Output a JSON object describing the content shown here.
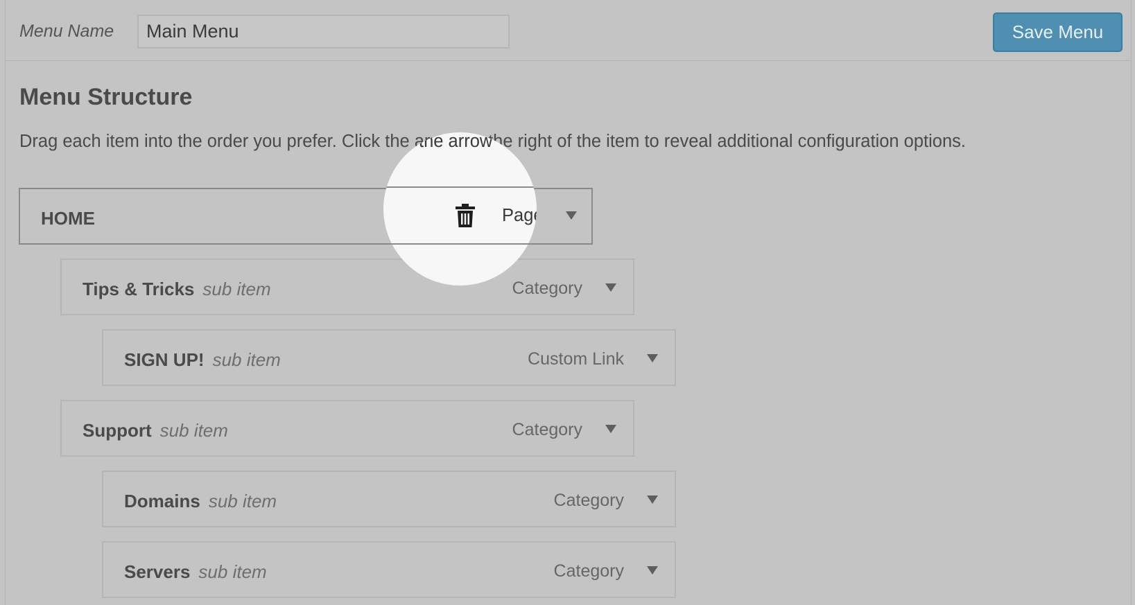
{
  "header": {
    "menu_name_label": "Menu Name",
    "menu_name_value": "Main Menu",
    "save_label": "Save Menu"
  },
  "structure": {
    "title": "Menu Structure",
    "instructions": "Drag each item into the order you prefer. Click the arrow on the right of the item to reveal additional configuration options."
  },
  "items": [
    {
      "title": "HOME",
      "sub": "",
      "type": "Page"
    },
    {
      "title": "Tips & Tricks",
      "sub": "sub item",
      "type": "Category"
    },
    {
      "title": "SIGN UP!",
      "sub": "sub item",
      "type": "Custom Link"
    },
    {
      "title": "Support",
      "sub": "sub item",
      "type": "Category"
    },
    {
      "title": "Domains",
      "sub": "sub item",
      "type": "Category"
    },
    {
      "title": "Servers",
      "sub": "sub item",
      "type": "Category"
    }
  ],
  "icons": {
    "delete": "trash-icon",
    "expand": "triangle-down-icon"
  },
  "colors": {
    "background": "#c4c4c4",
    "save_button": "#4e8fb2",
    "spotlight": "#f7f7f7"
  }
}
